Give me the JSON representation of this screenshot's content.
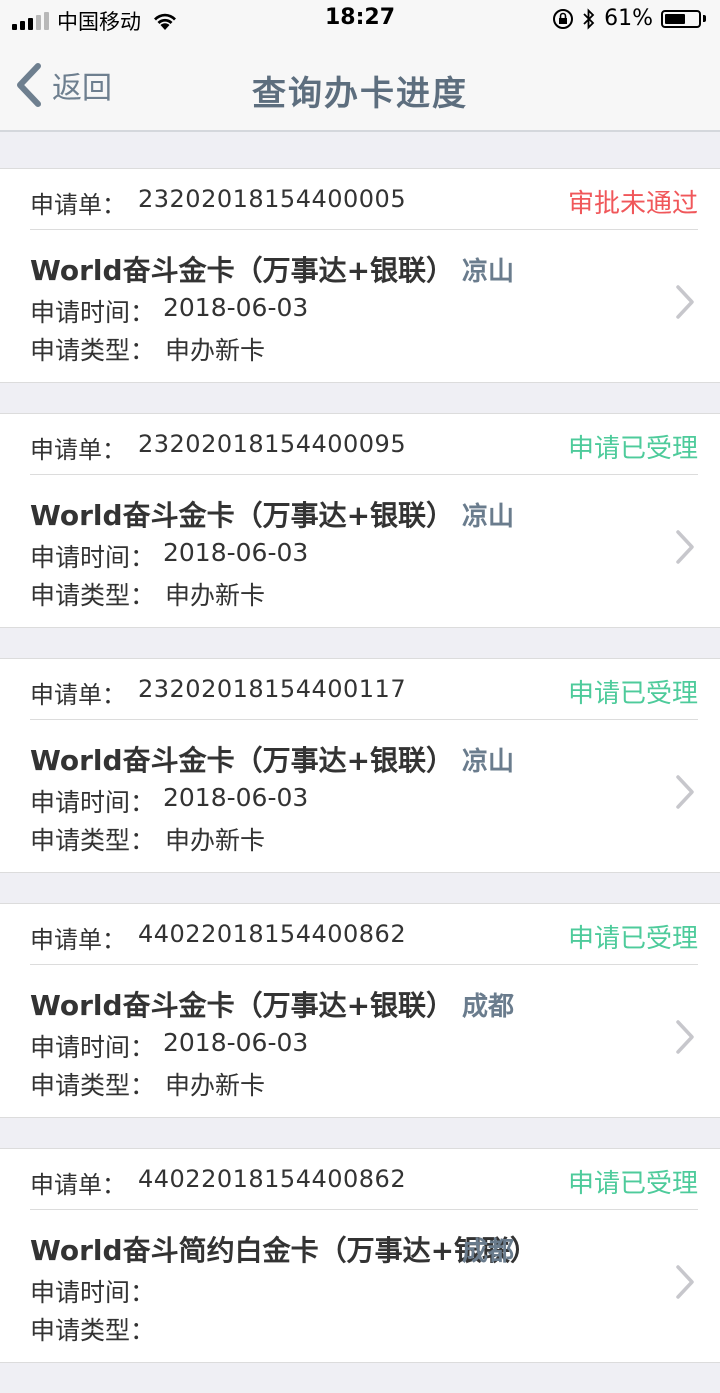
{
  "status_bar": {
    "carrier": "中国移动",
    "time": "18:27",
    "battery": "61%",
    "battery_level": 0.61
  },
  "nav": {
    "back_label": "返回",
    "title": "查询办卡进度"
  },
  "colors": {
    "rejected": "#f0575a",
    "accepted": "#4ecb9b",
    "city": "#6a7c8d",
    "nav_title": "#5d6e7e"
  },
  "labels": {
    "order": "申请单：",
    "time": "申请时间：",
    "type": "申请类型："
  },
  "applications": [
    {
      "order_no": "23202018154400005",
      "status": "审批未通过",
      "status_kind": "rejected",
      "card_name": "World奋斗金卡（万事达+银联）",
      "city": "凉山",
      "time": "2018-06-03",
      "type": "申办新卡"
    },
    {
      "order_no": "23202018154400095",
      "status": "申请已受理",
      "status_kind": "accepted",
      "card_name": "World奋斗金卡（万事达+银联）",
      "city": "凉山",
      "time": "2018-06-03",
      "type": "申办新卡"
    },
    {
      "order_no": "23202018154400117",
      "status": "申请已受理",
      "status_kind": "accepted",
      "card_name": "World奋斗金卡（万事达+银联）",
      "city": "凉山",
      "time": "2018-06-03",
      "type": "申办新卡"
    },
    {
      "order_no": "44022018154400862",
      "status": "申请已受理",
      "status_kind": "accepted",
      "card_name": "World奋斗金卡（万事达+银联）",
      "city": "成都",
      "time": "2018-06-03",
      "type": "申办新卡"
    },
    {
      "order_no": "44022018154400862",
      "status": "申请已受理",
      "status_kind": "accepted",
      "card_name": "World奋斗简约白金卡（万事达+银联）",
      "city": "成都",
      "time": "",
      "type": ""
    }
  ]
}
